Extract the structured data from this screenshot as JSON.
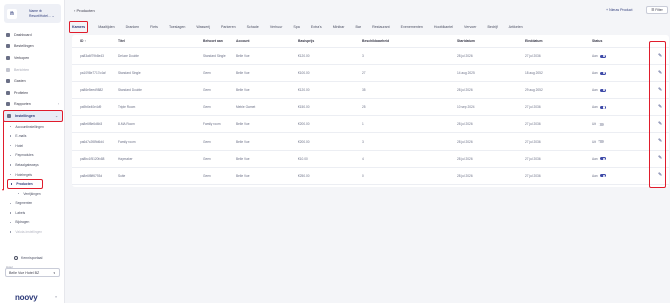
{
  "sidebar": {
    "logo_letter": "n",
    "account_name": "Name ⊕",
    "account_sub": "Resort/Hotel... ⌄",
    "nav": [
      {
        "label": "Dashboard",
        "icon": "dashboard-icon",
        "state": "normal"
      },
      {
        "label": "Bestellingen",
        "icon": "orders-icon",
        "state": "normal"
      },
      {
        "label": "Verkopen",
        "icon": "sales-icon",
        "state": "normal"
      },
      {
        "label": "Berichten",
        "icon": "messages-icon",
        "state": "disabled"
      },
      {
        "label": "Gasten",
        "icon": "guests-icon",
        "state": "normal"
      },
      {
        "label": "Profielen",
        "icon": "profiles-icon",
        "state": "normal"
      },
      {
        "label": "Rapporten",
        "icon": "reports-icon",
        "state": "normal",
        "chevron": "›"
      },
      {
        "label": "Instellingen",
        "icon": "settings-icon",
        "state": "active",
        "chevron": "⌄"
      }
    ],
    "sub_items": [
      {
        "label": "Accountinstellingen",
        "level": 1,
        "state": "normal"
      },
      {
        "label": "E-mails",
        "level": 1,
        "state": "normal"
      },
      {
        "label": "Hotel",
        "level": 1,
        "state": "normal"
      },
      {
        "label": "Paymodules",
        "level": 1,
        "state": "normal"
      },
      {
        "label": "Betaalgateways",
        "level": 1,
        "state": "normal"
      },
      {
        "label": "Hotelregels",
        "level": 1,
        "state": "normal"
      },
      {
        "label": "Producten",
        "level": 1,
        "state": "active"
      },
      {
        "label": "Verrijkingen",
        "level": 2,
        "state": "normal"
      },
      {
        "label": "Segmenten",
        "level": 1,
        "state": "normal"
      },
      {
        "label": "Labels",
        "level": 1,
        "state": "normal"
      },
      {
        "label": "Bijdragen",
        "level": 1,
        "state": "normal"
      },
      {
        "label": "Valuta-instellingen",
        "level": 1,
        "state": "muted"
      }
    ],
    "help_label": "Kennisportaal",
    "hotel_label": "Hotel",
    "hotel_value": "Belle Vue Hotel BZ",
    "brand": "noovy",
    "collapse_icon": "«"
  },
  "header": {
    "breadcrumb": "‹ Producten",
    "new_product": "+ Nieuw Product",
    "filter": "☰ Filter"
  },
  "tabs": [
    "Kamers",
    "Maaltijden",
    "Dranken",
    "Fiets",
    "Toeslagen",
    "Wasserij",
    "Parkeren",
    "Schade",
    "Verhuur",
    "Spa",
    "Extra's",
    "Minibar",
    "Bar",
    "Restaurant",
    "Evenementen",
    "Hoofdkantel",
    "Vervoer",
    "Bedrijf",
    "Artikelen"
  ],
  "table": {
    "columns": [
      "ID ↑",
      "Titel",
      "Behoort aan",
      "Account",
      "Basisprijs",
      "Beschikbaarheid",
      "Startdatum",
      "Einddatum",
      "Status"
    ],
    "rows": [
      {
        "id": "pa83a6f79b8e43",
        "title": "Deluxe Double",
        "belongs": "Standard Single",
        "account": "Belle Vue",
        "price": "€120.00",
        "avail": "3",
        "start": "28 jul 2026",
        "end": "27 jul 2036",
        "status": "Aan",
        "on": true
      },
      {
        "id": "pa1098e7717c4af",
        "title": "Standard Single",
        "belongs": "Geen",
        "account": "Belle Vue",
        "price": "€100.00",
        "avail": "27",
        "start": "14 aug 2025",
        "end": "18 aug 2052",
        "status": "Aan",
        "on": true
      },
      {
        "id": "pa86e5eed9882",
        "title": "Standard Double",
        "belongs": "Geen",
        "account": "Belle Vue",
        "price": "€120.00",
        "avail": "35",
        "start": "28 jul 2026",
        "end": "29 aug 2052",
        "status": "Aan",
        "on": true
      },
      {
        "id": "pa9b6e40e4d9",
        "title": "Triple Room",
        "belongs": "Geen",
        "account": "Meble Garnet",
        "price": "€150.00",
        "avail": "25",
        "start": "10 sep 2024",
        "end": "27 jul 2036",
        "status": "Aan",
        "on": true
      },
      {
        "id": "pa8e6f8e6d6b3",
        "title": "8-MA Room",
        "belongs": "Family room",
        "account": "Belle Vue",
        "price": "€200.00",
        "avail": "1",
        "start": "28 jul 2026",
        "end": "27 jul 2036",
        "status": "Uit",
        "on": false
      },
      {
        "id": "pa6d7c2f89d6d4",
        "title": "Family room",
        "belongs": "Geen",
        "account": "Belle Vue",
        "price": "€200.00",
        "avail": "3",
        "start": "28 jul 2026",
        "end": "27 jul 2036",
        "status": "Uit",
        "on": false
      },
      {
        "id": "pa8bc1f5120fc88",
        "title": "Haymaker",
        "belongs": "Geen",
        "account": "Belle Vue",
        "price": "€10.00",
        "avail": "4",
        "start": "28 jul 2026",
        "end": "27 jul 2036",
        "status": "Aan",
        "on": true
      },
      {
        "id": "pa8e6f8ff6793d",
        "title": "Suite",
        "belongs": "Geen",
        "account": "Belle Vue",
        "price": "€250.00",
        "avail": "0",
        "start": "28 jul 2026",
        "end": "27 jul 2036",
        "status": "Aan",
        "on": true
      }
    ]
  },
  "colors": {
    "accent": "#2e3b7a",
    "highlight": "#e01c2c",
    "toggle_on": "#3e4aa8"
  }
}
